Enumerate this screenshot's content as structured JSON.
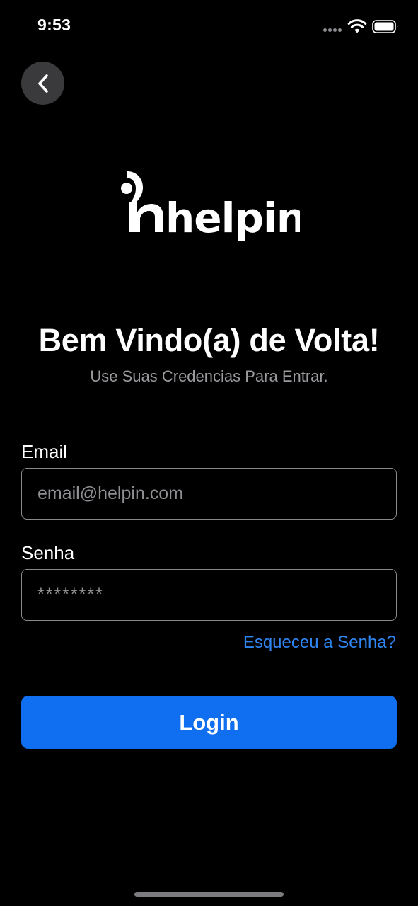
{
  "status_bar": {
    "time": "9:53",
    "signal_icon": "cellular-signal-dots-icon",
    "wifi_icon": "wifi-icon",
    "battery_icon": "battery-full-icon"
  },
  "navigation": {
    "back_icon": "chevron-left-icon"
  },
  "brand": {
    "name": "helpin"
  },
  "welcome": {
    "title": "Bem Vindo(a) de Volta!",
    "subtitle": "Use Suas Credencias Para Entrar."
  },
  "form": {
    "email_label": "Email",
    "email_placeholder": "email@helpin.com",
    "email_value": "",
    "password_label": "Senha",
    "password_placeholder": "********",
    "password_value": "",
    "forgot_password": "Esqueceu a Senha?",
    "login_label": "Login"
  },
  "colors": {
    "background": "#000000",
    "accent": "#0f6ff0",
    "link": "#2f86f2",
    "subtitle": "#9a9a9f",
    "input_border": "#8a8a8e",
    "back_button_bg": "#3a3a3c"
  }
}
